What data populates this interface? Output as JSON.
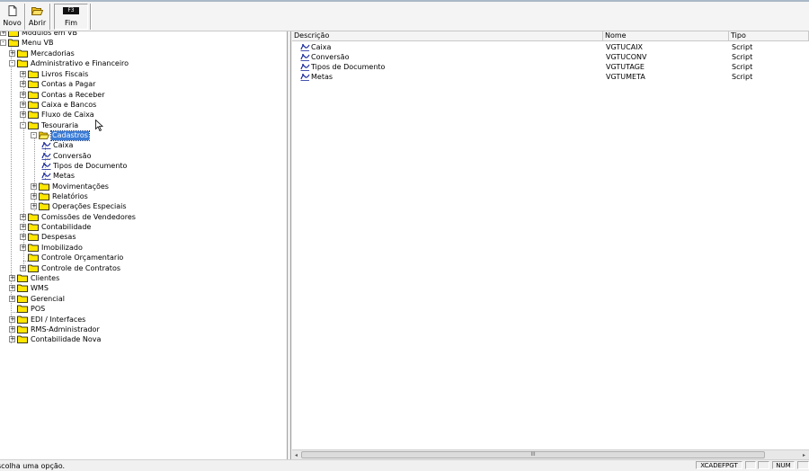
{
  "toolbar": {
    "novo_label": "Novo",
    "abrir_label": "Abrir",
    "fim_key": "F3",
    "fim_label": "Fim"
  },
  "tree": {
    "items": [
      {
        "label": "Modulos em VB",
        "expander": "+"
      },
      {
        "label": "Menu VB",
        "expander": "-"
      },
      {
        "label": "Mercadorias",
        "expander": "+"
      },
      {
        "label": "Administrativo e Financeiro",
        "expander": "-"
      },
      {
        "label": "Livros Fiscais",
        "expander": "+"
      },
      {
        "label": "Contas a Pagar",
        "expander": "+"
      },
      {
        "label": "Contas a Receber",
        "expander": "+"
      },
      {
        "label": "Caixa e Bancos",
        "expander": "+"
      },
      {
        "label": "Fluxo de Caixa",
        "expander": "+"
      },
      {
        "label": "Tesouraria",
        "expander": "-"
      },
      {
        "label": "Cadastros",
        "expander": "-"
      },
      {
        "label": "Caixa",
        "expander": ""
      },
      {
        "label": "Conversão",
        "expander": ""
      },
      {
        "label": "Tipos de Documento",
        "expander": ""
      },
      {
        "label": "Metas",
        "expander": ""
      },
      {
        "label": "Movimentações",
        "expander": "+"
      },
      {
        "label": "Relatórios",
        "expander": "+"
      },
      {
        "label": "Operações Especiais",
        "expander": "+"
      },
      {
        "label": "Comissões de Vendedores",
        "expander": "+"
      },
      {
        "label": "Contabilidade",
        "expander": "+"
      },
      {
        "label": "Despesas",
        "expander": "+"
      },
      {
        "label": "Imobilizado",
        "expander": "+"
      },
      {
        "label": "Controle Orçamentario",
        "expander": ""
      },
      {
        "label": "Controle de Contratos",
        "expander": "+"
      },
      {
        "label": "Clientes",
        "expander": "+"
      },
      {
        "label": "WMS",
        "expander": "+"
      },
      {
        "label": "Gerencial",
        "expander": "+"
      },
      {
        "label": "POS",
        "expander": ""
      },
      {
        "label": "EDI / Interfaces",
        "expander": "+"
      },
      {
        "label": "RMS-Administrador",
        "expander": "+"
      },
      {
        "label": "Contabilidade Nova",
        "expander": "+"
      }
    ]
  },
  "list": {
    "columns": [
      "Descrição",
      "Nome",
      "Tipo"
    ],
    "rows": [
      {
        "descricao": "Caixa",
        "nome": "VGTUCAIX",
        "tipo": "Script"
      },
      {
        "descricao": "Conversão",
        "nome": "VGTUCONV",
        "tipo": "Script"
      },
      {
        "descricao": "Tipos de Documento",
        "nome": "VGTUTAGE",
        "tipo": "Script"
      },
      {
        "descricao": "Metas",
        "nome": "VGTUMETA",
        "tipo": "Script"
      }
    ]
  },
  "scroll": {
    "thumb_grip": "III"
  },
  "statusbar": {
    "message": "scolha uma opção.",
    "user": "XCADEFPGT",
    "num": "NUM"
  },
  "colors": {
    "selection": "#3a7bd5",
    "folder": "#ffe600"
  }
}
